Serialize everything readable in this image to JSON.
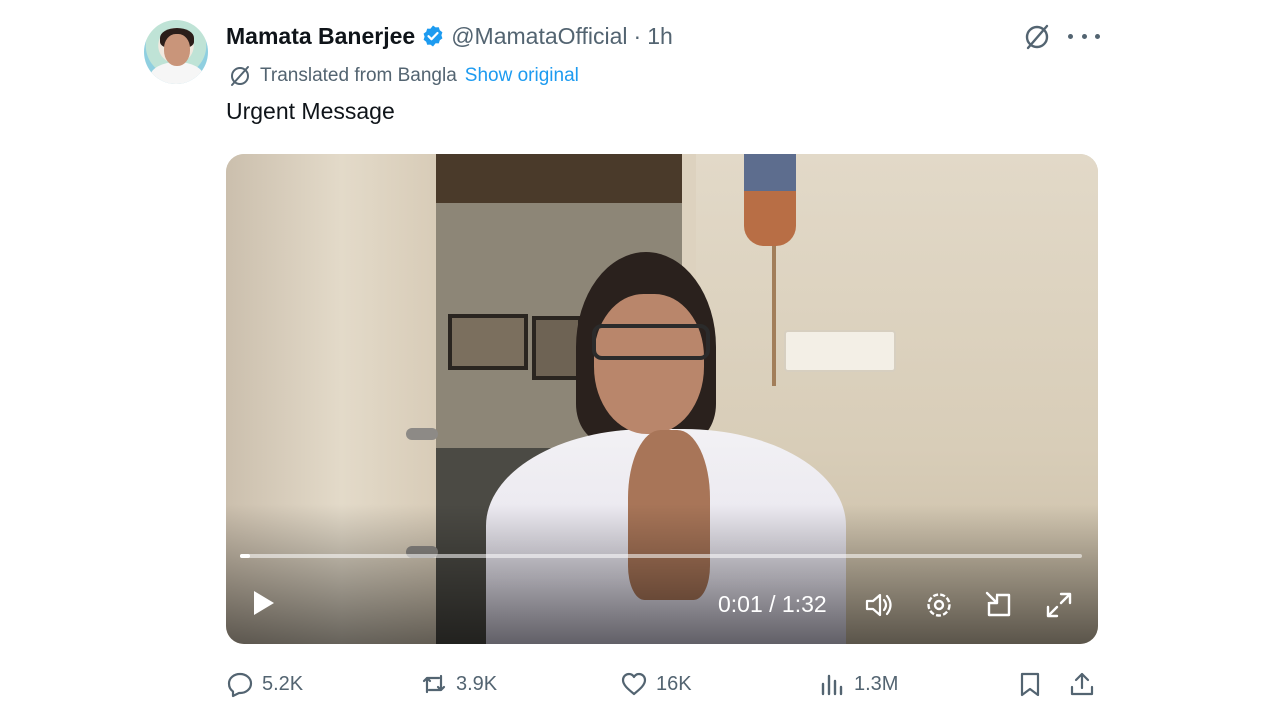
{
  "author": {
    "name": "Mamata Banerjee",
    "handle": "@MamataOfficial",
    "separator": "·",
    "time": "1h",
    "verified": true
  },
  "translation": {
    "label": "Translated from Bangla",
    "link": "Show original"
  },
  "tweet": {
    "text": "Urgent Message"
  },
  "video": {
    "time_readout": "0:01 / 1:32",
    "progress_fraction": 0.012
  },
  "actions": {
    "replies": "5.2K",
    "reposts": "3.9K",
    "likes": "16K",
    "views": "1.3M"
  },
  "colors": {
    "accent": "#1d9bf0",
    "muted": "#536471",
    "text": "#0f1419"
  },
  "icons": [
    "verified-badge-icon",
    "grok-icon",
    "more-icon",
    "translate-icon",
    "play-icon",
    "volume-icon",
    "settings-icon",
    "pip-icon",
    "fullscreen-icon",
    "reply-icon",
    "repost-icon",
    "like-icon",
    "views-icon",
    "bookmark-icon",
    "share-icon"
  ]
}
